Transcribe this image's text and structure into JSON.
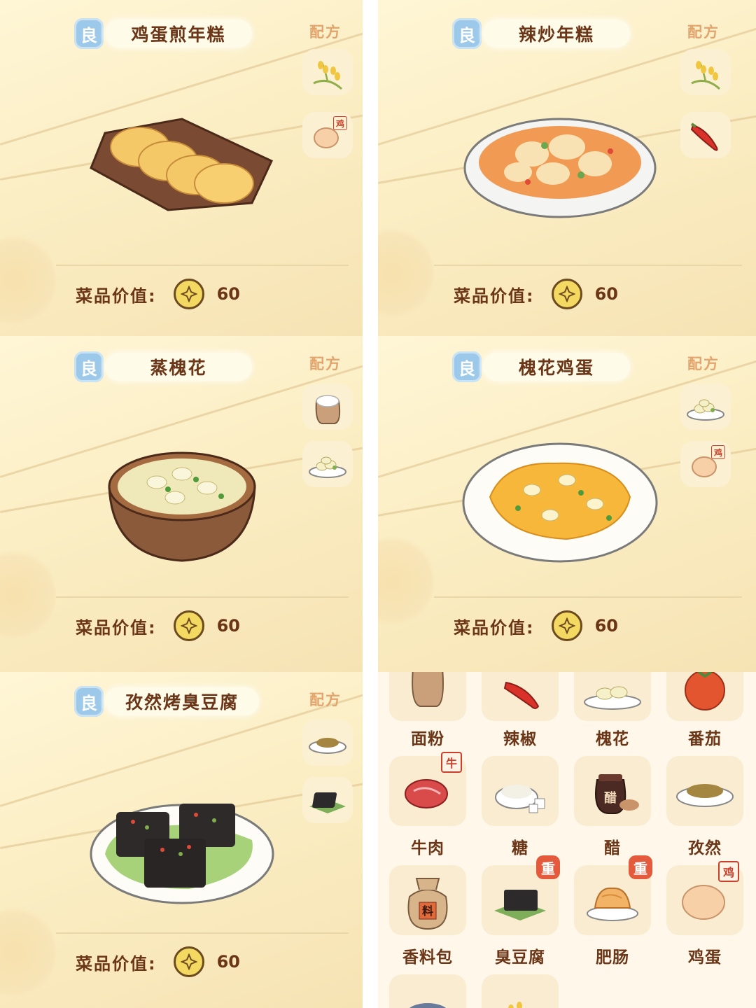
{
  "colors": {
    "panel_bg": "#fbeec4",
    "text_brown": "#6b3618",
    "recipe_orange": "#e2a36c",
    "grade_blue": "#9cc9e9",
    "coin_gold": "#f3d861",
    "tag_red": "#e35a3c"
  },
  "common": {
    "grade": "良",
    "recipe_label": "配方",
    "value_label": "菜品价值:"
  },
  "dishes": [
    {
      "name": "鸡蛋煎年糕",
      "value": "60",
      "ingredients": [
        "rice-stalk-icon",
        "egg-icon"
      ],
      "egg_tag": "鸡"
    },
    {
      "name": "辣炒年糕",
      "value": "60",
      "ingredients": [
        "rice-stalk-icon",
        "chili-icon"
      ]
    },
    {
      "name": "蒸槐花",
      "value": "60",
      "ingredients": [
        "flour-sack-icon",
        "locust-flower-icon"
      ]
    },
    {
      "name": "槐花鸡蛋",
      "value": "60",
      "ingredients": [
        "locust-flower-icon",
        "egg-icon"
      ],
      "egg_tag": "鸡"
    },
    {
      "name": "孜然烤臭豆腐",
      "value": "60",
      "ingredients": [
        "cumin-icon",
        "stinky-tofu-icon"
      ]
    }
  ],
  "ingredient_grid": {
    "items": [
      {
        "label": "面粉",
        "icon": "flour-sack-icon"
      },
      {
        "label": "辣椒",
        "icon": "chili-icon"
      },
      {
        "label": "槐花",
        "icon": "locust-flower-icon"
      },
      {
        "label": "番茄",
        "icon": "tomato-icon"
      },
      {
        "label": "牛肉",
        "icon": "beef-icon",
        "tag": "牛"
      },
      {
        "label": "糖",
        "icon": "sugar-icon"
      },
      {
        "label": "醋",
        "icon": "vinegar-jar-icon",
        "jar_text": "醋"
      },
      {
        "label": "孜然",
        "icon": "cumin-icon"
      },
      {
        "label": "香料包",
        "icon": "spice-bag-icon",
        "bag_text": "料"
      },
      {
        "label": "臭豆腐",
        "icon": "stinky-tofu-icon",
        "tag": "重"
      },
      {
        "label": "肥肠",
        "icon": "pork-intestine-icon",
        "tag": "重"
      },
      {
        "label": "鸡蛋",
        "icon": "egg-icon",
        "tag": "鸡"
      }
    ]
  }
}
